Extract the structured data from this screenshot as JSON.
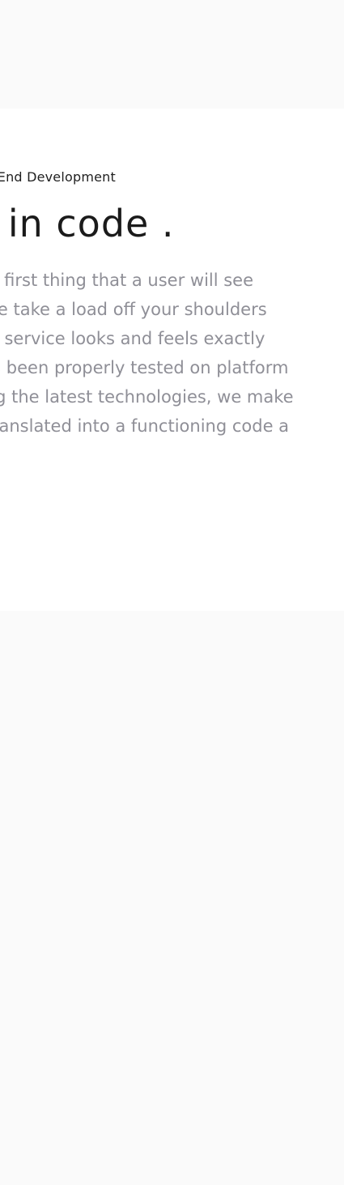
{
  "section": {
    "eyebrow": "ont-End Development",
    "headline": "g in code .",
    "body_lines": [
      "the first thing that a user will see",
      ". We take a load off your shoulders",
      "our service looks and feels exactly",
      "has been properly tested on platform",
      "sing the latest technologies, we make",
      "s translated into a functioning code a"
    ]
  },
  "colors": {
    "page_background": "#fafafa",
    "section_background": "#ffffff",
    "heading": "#1b1b1b",
    "body_text": "#8f8f97"
  }
}
